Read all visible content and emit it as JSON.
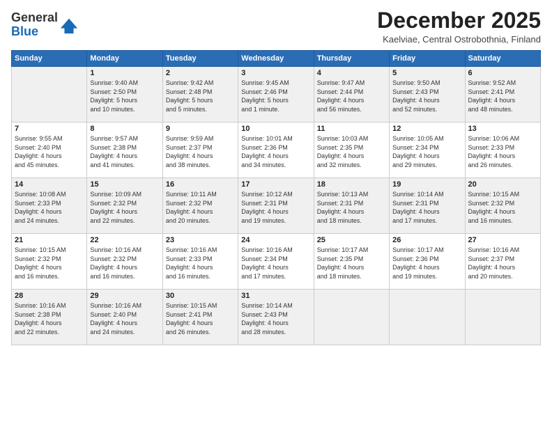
{
  "header": {
    "logo_line1": "General",
    "logo_line2": "Blue",
    "month_title": "December 2025",
    "location": "Kaelviae, Central Ostrobothnia, Finland"
  },
  "weekdays": [
    "Sunday",
    "Monday",
    "Tuesday",
    "Wednesday",
    "Thursday",
    "Friday",
    "Saturday"
  ],
  "weeks": [
    [
      {
        "day": "",
        "info": ""
      },
      {
        "day": "1",
        "info": "Sunrise: 9:40 AM\nSunset: 2:50 PM\nDaylight: 5 hours\nand 10 minutes."
      },
      {
        "day": "2",
        "info": "Sunrise: 9:42 AM\nSunset: 2:48 PM\nDaylight: 5 hours\nand 5 minutes."
      },
      {
        "day": "3",
        "info": "Sunrise: 9:45 AM\nSunset: 2:46 PM\nDaylight: 5 hours\nand 1 minute."
      },
      {
        "day": "4",
        "info": "Sunrise: 9:47 AM\nSunset: 2:44 PM\nDaylight: 4 hours\nand 56 minutes."
      },
      {
        "day": "5",
        "info": "Sunrise: 9:50 AM\nSunset: 2:43 PM\nDaylight: 4 hours\nand 52 minutes."
      },
      {
        "day": "6",
        "info": "Sunrise: 9:52 AM\nSunset: 2:41 PM\nDaylight: 4 hours\nand 48 minutes."
      }
    ],
    [
      {
        "day": "7",
        "info": "Sunrise: 9:55 AM\nSunset: 2:40 PM\nDaylight: 4 hours\nand 45 minutes."
      },
      {
        "day": "8",
        "info": "Sunrise: 9:57 AM\nSunset: 2:38 PM\nDaylight: 4 hours\nand 41 minutes."
      },
      {
        "day": "9",
        "info": "Sunrise: 9:59 AM\nSunset: 2:37 PM\nDaylight: 4 hours\nand 38 minutes."
      },
      {
        "day": "10",
        "info": "Sunrise: 10:01 AM\nSunset: 2:36 PM\nDaylight: 4 hours\nand 34 minutes."
      },
      {
        "day": "11",
        "info": "Sunrise: 10:03 AM\nSunset: 2:35 PM\nDaylight: 4 hours\nand 32 minutes."
      },
      {
        "day": "12",
        "info": "Sunrise: 10:05 AM\nSunset: 2:34 PM\nDaylight: 4 hours\nand 29 minutes."
      },
      {
        "day": "13",
        "info": "Sunrise: 10:06 AM\nSunset: 2:33 PM\nDaylight: 4 hours\nand 26 minutes."
      }
    ],
    [
      {
        "day": "14",
        "info": "Sunrise: 10:08 AM\nSunset: 2:33 PM\nDaylight: 4 hours\nand 24 minutes."
      },
      {
        "day": "15",
        "info": "Sunrise: 10:09 AM\nSunset: 2:32 PM\nDaylight: 4 hours\nand 22 minutes."
      },
      {
        "day": "16",
        "info": "Sunrise: 10:11 AM\nSunset: 2:32 PM\nDaylight: 4 hours\nand 20 minutes."
      },
      {
        "day": "17",
        "info": "Sunrise: 10:12 AM\nSunset: 2:31 PM\nDaylight: 4 hours\nand 19 minutes."
      },
      {
        "day": "18",
        "info": "Sunrise: 10:13 AM\nSunset: 2:31 PM\nDaylight: 4 hours\nand 18 minutes."
      },
      {
        "day": "19",
        "info": "Sunrise: 10:14 AM\nSunset: 2:31 PM\nDaylight: 4 hours\nand 17 minutes."
      },
      {
        "day": "20",
        "info": "Sunrise: 10:15 AM\nSunset: 2:32 PM\nDaylight: 4 hours\nand 16 minutes."
      }
    ],
    [
      {
        "day": "21",
        "info": "Sunrise: 10:15 AM\nSunset: 2:32 PM\nDaylight: 4 hours\nand 16 minutes."
      },
      {
        "day": "22",
        "info": "Sunrise: 10:16 AM\nSunset: 2:32 PM\nDaylight: 4 hours\nand 16 minutes."
      },
      {
        "day": "23",
        "info": "Sunrise: 10:16 AM\nSunset: 2:33 PM\nDaylight: 4 hours\nand 16 minutes."
      },
      {
        "day": "24",
        "info": "Sunrise: 10:16 AM\nSunset: 2:34 PM\nDaylight: 4 hours\nand 17 minutes."
      },
      {
        "day": "25",
        "info": "Sunrise: 10:17 AM\nSunset: 2:35 PM\nDaylight: 4 hours\nand 18 minutes."
      },
      {
        "day": "26",
        "info": "Sunrise: 10:17 AM\nSunset: 2:36 PM\nDaylight: 4 hours\nand 19 minutes."
      },
      {
        "day": "27",
        "info": "Sunrise: 10:16 AM\nSunset: 2:37 PM\nDaylight: 4 hours\nand 20 minutes."
      }
    ],
    [
      {
        "day": "28",
        "info": "Sunrise: 10:16 AM\nSunset: 2:38 PM\nDaylight: 4 hours\nand 22 minutes."
      },
      {
        "day": "29",
        "info": "Sunrise: 10:16 AM\nSunset: 2:40 PM\nDaylight: 4 hours\nand 24 minutes."
      },
      {
        "day": "30",
        "info": "Sunrise: 10:15 AM\nSunset: 2:41 PM\nDaylight: 4 hours\nand 26 minutes."
      },
      {
        "day": "31",
        "info": "Sunrise: 10:14 AM\nSunset: 2:43 PM\nDaylight: 4 hours\nand 28 minutes."
      },
      {
        "day": "",
        "info": ""
      },
      {
        "day": "",
        "info": ""
      },
      {
        "day": "",
        "info": ""
      }
    ]
  ]
}
